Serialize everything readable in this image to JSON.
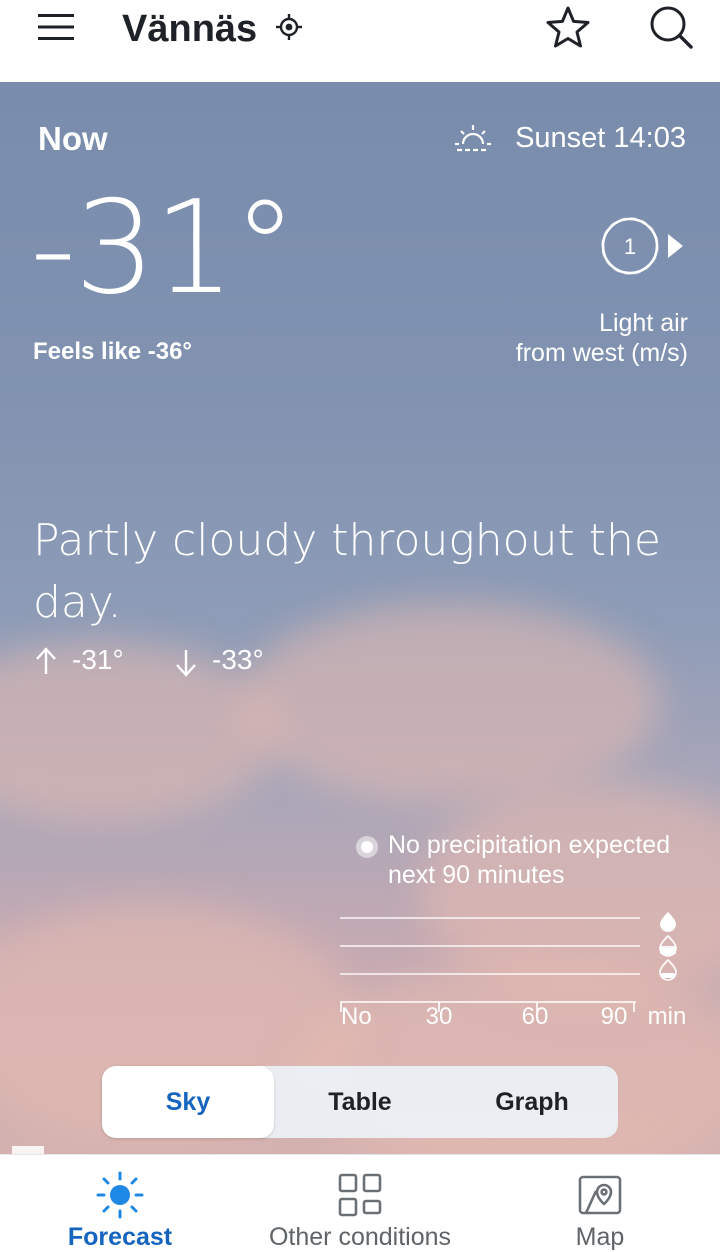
{
  "header": {
    "city": "Vännäs"
  },
  "now": {
    "label": "Now",
    "sunset": "Sunset 14:03",
    "temperature": "-31°",
    "feels_like": "Feels like -36°",
    "wind_speed": "1",
    "wind_desc_1": "Light air",
    "wind_desc_2": "from west (m/s)"
  },
  "summary": {
    "text": "Partly cloudy throughout the day.",
    "high": "-31°",
    "low": "-33°"
  },
  "precipitation": {
    "line1": "No precipitation expected",
    "line2": "next 90 minutes",
    "axis": [
      "No",
      "30",
      "60",
      "90"
    ],
    "axis_unit": "min"
  },
  "view_tabs": {
    "sky": "Sky",
    "table": "Table",
    "graph": "Graph",
    "selected": "Sky"
  },
  "bottom_nav": {
    "forecast": "Forecast",
    "other": "Other conditions",
    "map": "Map",
    "active": "Forecast"
  },
  "colors": {
    "accent": "#1565c0",
    "text_dark": "#1e2228"
  }
}
